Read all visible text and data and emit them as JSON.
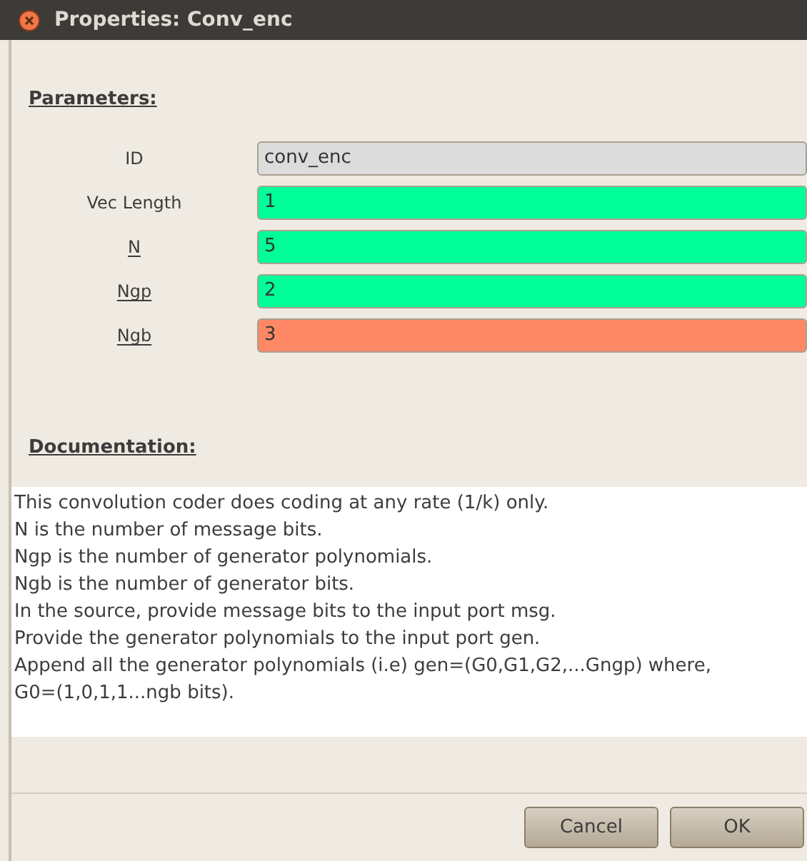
{
  "window": {
    "title": "Properties: Conv_enc"
  },
  "parameters": {
    "heading": "Parameters:",
    "rows": [
      {
        "label": "ID",
        "underlined": false,
        "value": "conv_enc",
        "color": "#dcdcdc"
      },
      {
        "label": "Vec Length",
        "underlined": false,
        "value": "1",
        "color": "#00ff99"
      },
      {
        "label": "N",
        "underlined": true,
        "value": "5",
        "color": "#00ff99"
      },
      {
        "label": "Ngp",
        "underlined": true,
        "value": "2",
        "color": "#00ff99"
      },
      {
        "label": "Ngb",
        "underlined": true,
        "value": "3",
        "color": "#ff8866"
      }
    ]
  },
  "documentation": {
    "heading": "Documentation:",
    "lines": [
      "This convolution coder does coding at any rate (1/k) only.",
      "N is the number of message bits.",
      "Ngp is the number of generator polynomials.",
      "Ngb is the number of generator bits.",
      "In the source, provide message bits to the input port msg.",
      "Provide the generator polynomials to the input port gen.",
      "Append all the generator polynomials (i.e) gen=(G0,G1,G2,...Gngp) where,",
      "G0=(1,0,1,1...ngb bits)."
    ]
  },
  "buttons": [
    "Cancel",
    "OK"
  ]
}
